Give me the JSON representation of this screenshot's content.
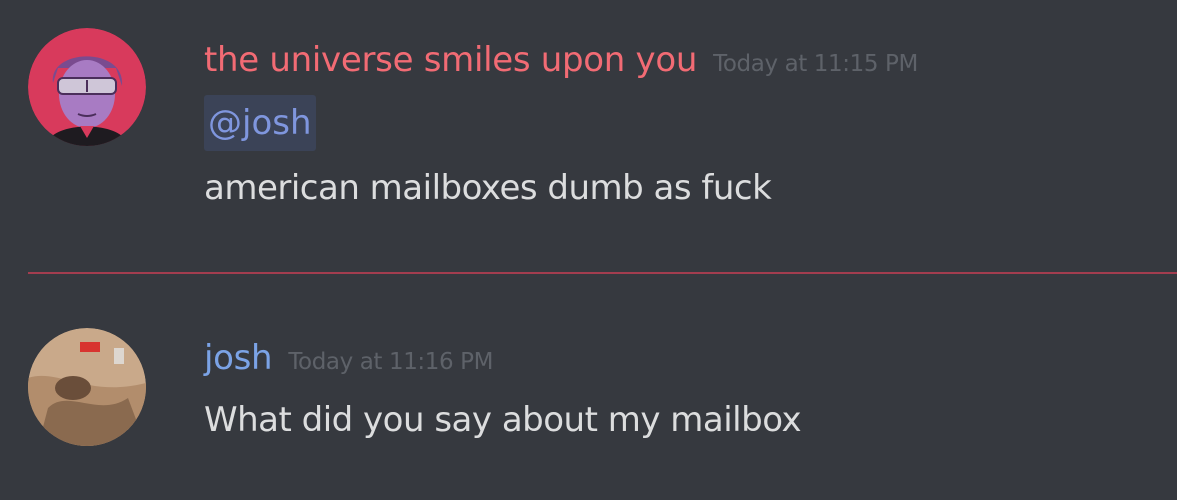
{
  "messages": [
    {
      "author": "the universe smiles upon you",
      "author_color": "#f26b74",
      "timestamp": "Today at 11:15 PM",
      "mention": "@josh",
      "text": "american mailboxes dumb as fuck"
    },
    {
      "author": "josh",
      "author_color": "#7ba3e6",
      "timestamp": "Today at 11:16 PM",
      "text": "What did you say about my mailbox"
    }
  ],
  "colors": {
    "background": "#36393f",
    "message_text": "#dcddde",
    "timestamp": "#5e6269",
    "mention_bg": "#3b4357",
    "mention_text": "#7f96de",
    "new_divider": "#a33d4f"
  }
}
